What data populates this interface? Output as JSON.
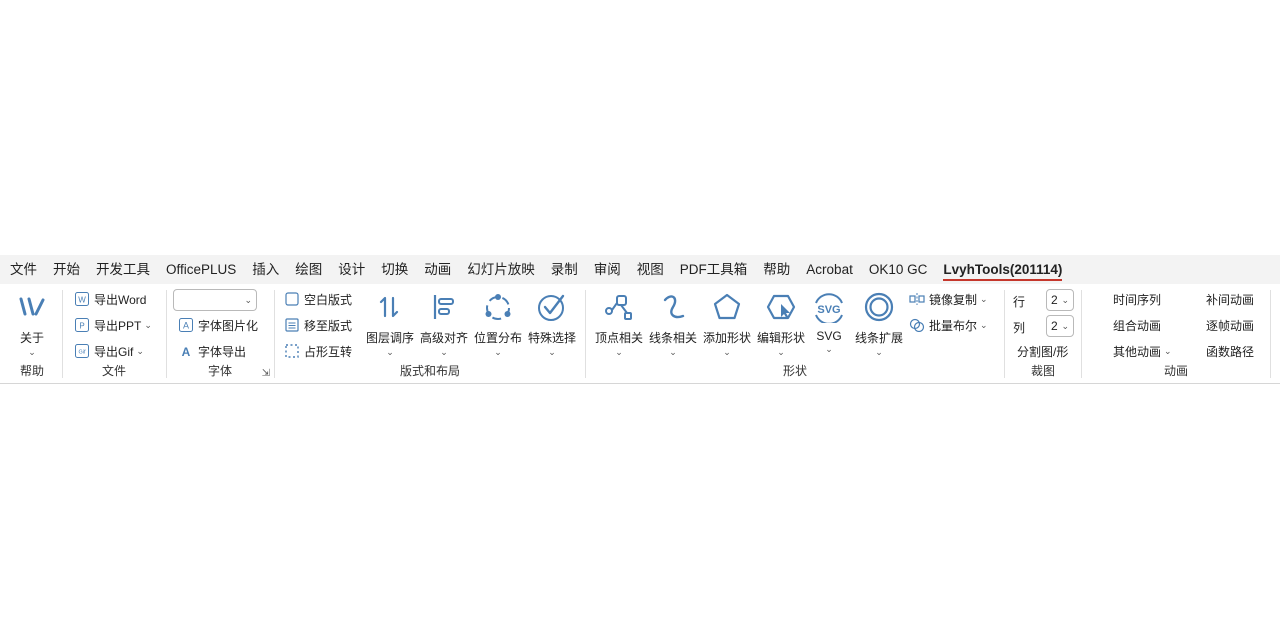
{
  "tabs": [
    {
      "label": "文件"
    },
    {
      "label": "开始"
    },
    {
      "label": "开发工具"
    },
    {
      "label": "OfficePLUS"
    },
    {
      "label": "插入"
    },
    {
      "label": "绘图"
    },
    {
      "label": "设计"
    },
    {
      "label": "切换"
    },
    {
      "label": "动画"
    },
    {
      "label": "幻灯片放映"
    },
    {
      "label": "录制"
    },
    {
      "label": "审阅"
    },
    {
      "label": "视图"
    },
    {
      "label": "PDF工具箱"
    },
    {
      "label": "帮助"
    },
    {
      "label": "Acrobat"
    },
    {
      "label": "OK10 GC"
    },
    {
      "label": "LvyhTools(201114)"
    }
  ],
  "active_tab": "LvyhTools(201114)",
  "accent_color": "#c5372c",
  "icon_color": "#4a7fb5",
  "groups": {
    "help": {
      "label": "帮助",
      "about": "关于"
    },
    "file": {
      "label": "文件",
      "export_word": "导出Word",
      "export_ppt": "导出PPT",
      "export_gif": "导出Gif"
    },
    "font": {
      "label": "字体",
      "font_select_value": "",
      "font_to_image": "字体图片化",
      "font_export": "字体导出"
    },
    "layout": {
      "label": "版式和布局",
      "blank_layout": "空白版式",
      "move_to_layout": "移至版式",
      "placeholder_swap": "占形互转",
      "layer_order": "图层调序",
      "advanced_align": "高级对齐",
      "position_distribute": "位置分布",
      "special_select": "特殊选择"
    },
    "shape": {
      "label": "形状",
      "vertex": "顶点相关",
      "line": "线条相关",
      "add_shape": "添加形状",
      "edit_shape": "编辑形状",
      "svg": "SVG",
      "line_expand": "线条扩展",
      "mirror_copy": "镜像复制",
      "batch_boolean": "批量布尔"
    },
    "crop": {
      "label": "裁图",
      "row_label": "行",
      "row_value": "2",
      "col_label": "列",
      "col_value": "2",
      "split": "分割图/形"
    },
    "animation": {
      "label": "动画",
      "time_sequence": "时间序列",
      "tween": "补间动画",
      "combine": "组合动画",
      "frame_by_frame": "逐帧动画",
      "other": "其他动画",
      "function_path": "函数路径"
    }
  }
}
